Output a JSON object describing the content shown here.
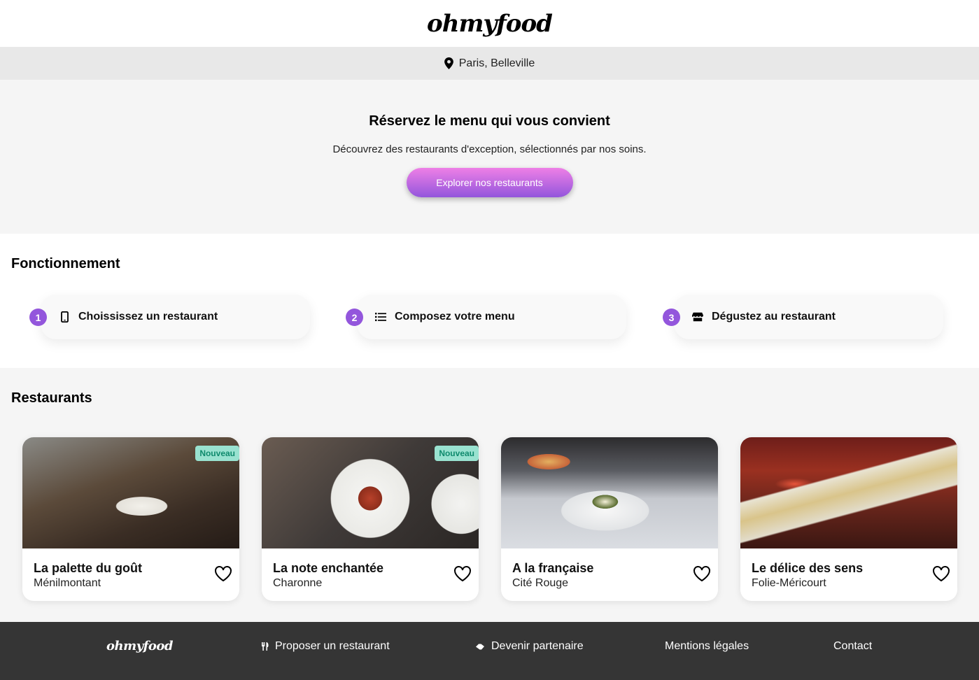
{
  "header": {
    "logo": "ohmyfood"
  },
  "location": {
    "icon": "map-pin-icon",
    "text": "Paris, Belleville"
  },
  "hero": {
    "title": "Réservez le menu qui vous convient",
    "subtitle": "Découvrez des restaurants d'exception, sélectionnés par nos soins.",
    "cta_label": "Explorer nos restaurants"
  },
  "how": {
    "title": "Fonctionnement",
    "steps": [
      {
        "num": "1",
        "icon": "mobile-phone-icon",
        "label": "Choississez un restaurant"
      },
      {
        "num": "2",
        "icon": "list-icon",
        "label": "Composez votre menu"
      },
      {
        "num": "3",
        "icon": "store-icon",
        "label": "Dégustez au restaurant"
      }
    ]
  },
  "restaurants": {
    "title": "Restaurants",
    "items": [
      {
        "name": "La palette du goût",
        "area": "Ménilmontant",
        "badge": "Nouveau"
      },
      {
        "name": "La note enchantée",
        "area": "Charonne",
        "badge": "Nouveau"
      },
      {
        "name": "A la française",
        "area": "Cité Rouge",
        "badge": ""
      },
      {
        "name": "Le délice des sens",
        "area": "Folie-Méricourt",
        "badge": ""
      }
    ]
  },
  "footer": {
    "logo": "ohmyfood",
    "links": [
      {
        "icon": "utensils-icon",
        "label": "Proposer un restaurant"
      },
      {
        "icon": "handshake-icon",
        "label": "Devenir partenaire"
      },
      {
        "icon": "",
        "label": "Mentions légales"
      },
      {
        "icon": "",
        "label": "Contact"
      }
    ]
  },
  "colors": {
    "accent": "#9356dc",
    "accent_light": "#ee7fe6",
    "badge_bg": "#99e2d0",
    "badge_text": "#0f8a6d",
    "footer_bg": "#353535"
  }
}
